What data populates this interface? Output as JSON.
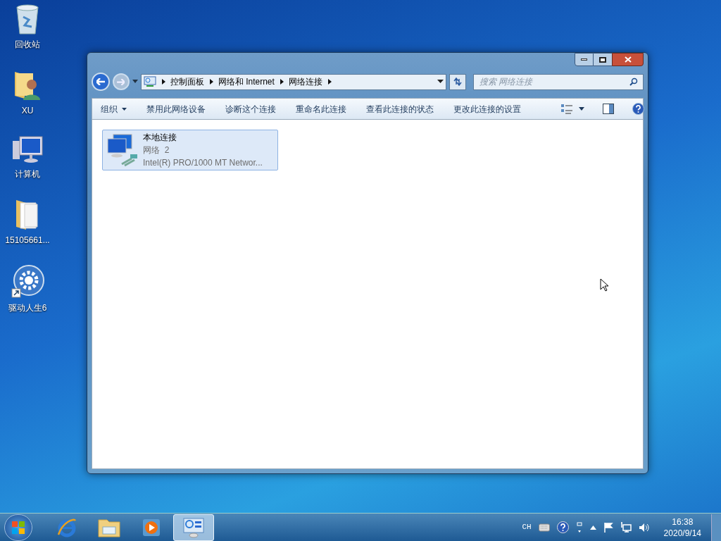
{
  "desktop_icons": [
    {
      "label": "回收站",
      "kind": "trash"
    },
    {
      "label": "XU",
      "kind": "user"
    },
    {
      "label": "计算机",
      "kind": "computer"
    },
    {
      "label": "15105661...",
      "kind": "folder"
    },
    {
      "label": "驱动人生6",
      "kind": "gear"
    }
  ],
  "window": {
    "breadcrumb": [
      "控制面板",
      "网络和 Internet",
      "网络连接"
    ],
    "search": {
      "placeholder": "搜索 网络连接"
    },
    "toolbar": {
      "organize": "组织",
      "commands": [
        "禁用此网络设备",
        "诊断这个连接",
        "重命名此连接",
        "查看此连接的状态",
        "更改此连接的设置"
      ]
    },
    "items": [
      {
        "name": "本地连接",
        "network": "网络  2",
        "adapter": "Intel(R) PRO/1000 MT Networ...",
        "selected": true
      }
    ]
  },
  "taskbar": {
    "apps": [
      {
        "kind": "browser",
        "selected": false
      },
      {
        "kind": "explorer",
        "selected": false
      },
      {
        "kind": "media",
        "selected": false
      },
      {
        "kind": "control",
        "selected": true
      }
    ],
    "language": "CH",
    "time": "16:38",
    "date": "2020/9/14"
  }
}
